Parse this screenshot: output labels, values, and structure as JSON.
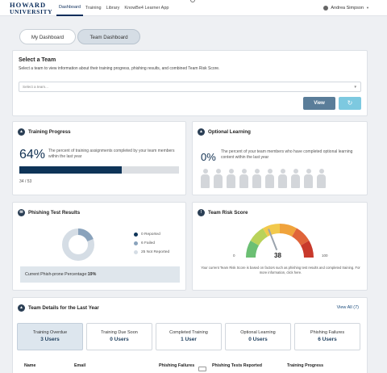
{
  "header": {
    "logo_line1": "HOWARD",
    "logo_line2": "UNIVERSITY",
    "nav": [
      "Dashboard",
      "Training",
      "Library",
      "KnowBe4 Learner App"
    ],
    "user_name": "Andrea Simpson"
  },
  "tabs": {
    "my": "My Dashboard",
    "team": "Team Dashboard"
  },
  "select_team": {
    "title": "Select a Team",
    "description": "Select a team to view information about their training progress, phishing results, and combined Team Risk Score.",
    "placeholder": "Select a team...",
    "view_label": "View",
    "reset_icon": "↻"
  },
  "training_progress": {
    "title": "Training Progress",
    "percent": "64%",
    "progress_fraction": 0.64,
    "description": "The percent of training assignments completed by your team members within the last year",
    "count": "34 / 53"
  },
  "optional_learning": {
    "title": "Optional Learning",
    "percent": "0%",
    "description": "The percent of your team members who have completed optional learning content within the last year",
    "people_count": 10
  },
  "phishing": {
    "title": "Phishing Test Results",
    "legend": [
      {
        "label": "0 Reported",
        "color": "#0e3458",
        "value": 0
      },
      {
        "label": "6 Failed",
        "color": "#8aa3bc",
        "value": 6
      },
      {
        "label": "25 Not Reported",
        "color": "#d5dde5",
        "value": 25
      }
    ],
    "footer_label": "Current Phish-prone Percentage:",
    "footer_value": "19%"
  },
  "risk": {
    "title": "Team Risk Score",
    "min": "0",
    "max": "100",
    "value": "38",
    "score": 38,
    "colors": [
      "#6bbf73",
      "#b9d25a",
      "#f2c94c",
      "#f0a33c",
      "#e0643a",
      "#c8392b"
    ],
    "description": "Your current Team Risk Score is based on factors such as phishing test results and completed training. For more information, click here."
  },
  "team_details": {
    "title": "Team Details for the Last Year",
    "view_all": "View All (7)",
    "stats": [
      {
        "label": "Training Overdue",
        "value": "3 Users"
      },
      {
        "label": "Training Due Soon",
        "value": "0 Users"
      },
      {
        "label": "Completed Training",
        "value": "1 User"
      },
      {
        "label": "Optional Learning",
        "value": "0 Users"
      },
      {
        "label": "Phishing Failures",
        "value": "6 Users"
      }
    ],
    "columns": [
      "Name",
      "Email",
      "Phishing Failures",
      "Phishing Tests Reported",
      "Training Progress"
    ]
  }
}
